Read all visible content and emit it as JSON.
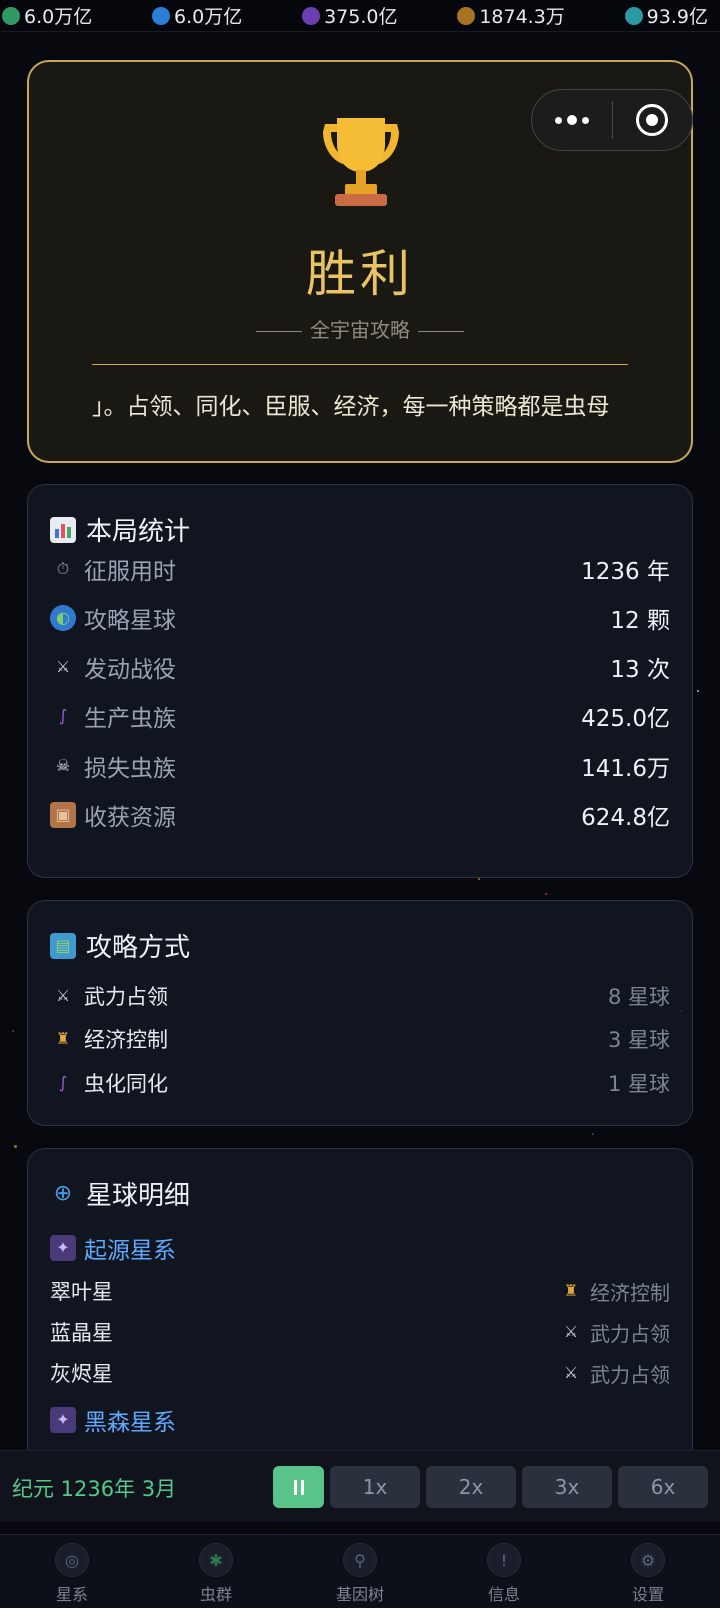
{
  "resources": [
    {
      "icon": "green-gem-icon",
      "color": "#2f9a63",
      "value": "6.0万亿"
    },
    {
      "icon": "blue-crystal-icon",
      "color": "#2b7fd8",
      "value": "6.0万亿"
    },
    {
      "icon": "purple-orb-icon",
      "color": "#6b3fb0",
      "value": "375.0亿"
    },
    {
      "icon": "gold-coin-icon",
      "color": "#a87422",
      "value": "1874.3万"
    },
    {
      "icon": "cyan-gear-icon",
      "color": "#2a9aa3",
      "value": "93.9亿"
    }
  ],
  "victory": {
    "title": "胜利",
    "subtitle": "全宇宙攻略",
    "description": "」。占领、同化、臣服、经济，每一种策略都是虫母"
  },
  "stats": {
    "title": "本局统计",
    "rows": [
      {
        "icon": "stopwatch-icon",
        "label": "征服用时",
        "value": "1236 年"
      },
      {
        "icon": "globe-icon",
        "label": "攻略星球",
        "value": "12 颗"
      },
      {
        "icon": "crossed-swords-icon",
        "label": "发动战役",
        "value": "13 次"
      },
      {
        "icon": "worm-icon",
        "label": "生产虫族",
        "value": "425.0亿"
      },
      {
        "icon": "skull-icon",
        "label": "损失虫族",
        "value": "141.6万"
      },
      {
        "icon": "package-icon",
        "label": "收获资源",
        "value": "624.8亿"
      }
    ]
  },
  "modes": {
    "title": "攻略方式",
    "rows": [
      {
        "icon": "crossed-swords-icon",
        "label": "武力占领",
        "value": "8 星球"
      },
      {
        "icon": "money-bag-icon",
        "label": "经济控制",
        "value": "3 星球"
      },
      {
        "icon": "worm-icon",
        "label": "虫化同化",
        "value": "1 星球"
      }
    ]
  },
  "planets": {
    "title": "星球明细",
    "systems": [
      {
        "name": "起源星系",
        "planets": [
          {
            "name": "翠叶星",
            "mode": "经济控制",
            "icon": "money-bag-icon"
          },
          {
            "name": "蓝晶星",
            "mode": "武力占领",
            "icon": "crossed-swords-icon"
          },
          {
            "name": "灰烬星",
            "mode": "武力占领",
            "icon": "crossed-swords-icon"
          }
        ]
      },
      {
        "name": "黑森星系",
        "planets": []
      }
    ]
  },
  "control": {
    "era": "纪元 1236年 3月",
    "speeds": [
      "1x",
      "2x",
      "3x",
      "6x"
    ]
  },
  "nav": [
    {
      "icon": "galaxy-icon",
      "label": "星系"
    },
    {
      "icon": "swarm-icon",
      "label": "虫群"
    },
    {
      "icon": "gene-tree-icon",
      "label": "基因树"
    },
    {
      "icon": "info-icon",
      "label": "信息"
    },
    {
      "icon": "settings-gear-icon",
      "label": "设置"
    }
  ],
  "colors": {
    "gold": "#e8c466",
    "accent_green": "#58c489",
    "link_blue": "#5fa9ff"
  }
}
